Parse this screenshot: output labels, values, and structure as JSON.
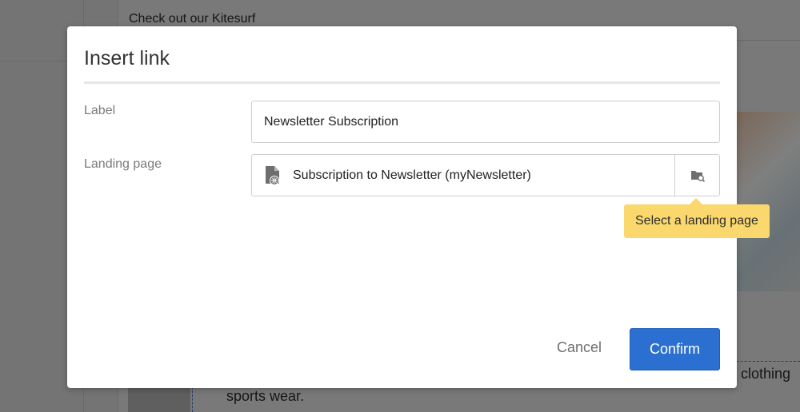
{
  "background": {
    "top_text": "Check out our Kitesurf",
    "right_fragment": "or clothing",
    "bottom_text": "sports wear."
  },
  "dialog": {
    "title": "Insert link",
    "label_field": {
      "label": "Label",
      "value": "Newsletter Subscription"
    },
    "landing_page_field": {
      "label": "Landing page",
      "value": "Subscription to Newsletter (myNewsletter)",
      "icon": "landing-page-doc-icon",
      "browse_icon": "folder-search-icon"
    },
    "tooltip": "Select a landing page",
    "buttons": {
      "cancel": "Cancel",
      "confirm": "Confirm"
    }
  },
  "colors": {
    "accent": "#2b6fd1",
    "tooltip_bg": "#fbd86d"
  }
}
